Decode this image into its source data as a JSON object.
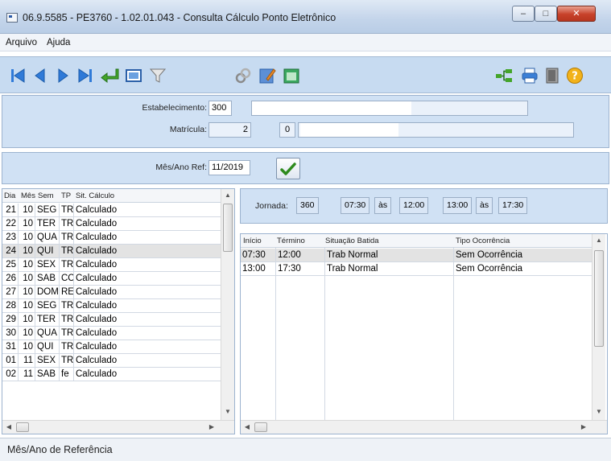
{
  "window": {
    "title": "06.9.5585 - PE3760 - 1.02.01.043 - Consulta Cálculo Ponto Eletrônico",
    "minimize": "–",
    "maximize": "□",
    "close": "✕"
  },
  "menu": {
    "arquivo": "Arquivo",
    "ajuda": "Ajuda"
  },
  "toolbar": {
    "icons": [
      "first-record-icon",
      "previous-record-icon",
      "next-record-icon",
      "last-record-icon",
      "enter-icon",
      "preview-icon",
      "filter-icon",
      "link-icon",
      "edit-icon",
      "calendar-icon",
      "tree-icon",
      "print-icon",
      "exit-door-icon",
      "help-icon"
    ]
  },
  "form": {
    "estabelecimento_label": "Estabelecimento:",
    "estabelecimento_value": "300",
    "matricula_label": "Matrícula:",
    "matricula_value": "2",
    "matricula_digit": "0",
    "mes_ano_label": "Mês/Ano Ref:",
    "mes_ano_value": "11/2019"
  },
  "days_grid": {
    "headers": [
      "Dia",
      "Mês",
      "Sem",
      "TP",
      "Sit. Cálculo"
    ],
    "rows": [
      [
        "21",
        "10",
        "SEG",
        "TR",
        "Calculado"
      ],
      [
        "22",
        "10",
        "TER",
        "TR",
        "Calculado"
      ],
      [
        "23",
        "10",
        "QUA",
        "TR",
        "Calculado"
      ],
      [
        "24",
        "10",
        "QUI",
        "TR",
        "Calculado"
      ],
      [
        "25",
        "10",
        "SEX",
        "TR",
        "Calculado"
      ],
      [
        "26",
        "10",
        "SAB",
        "CC",
        "Calculado"
      ],
      [
        "27",
        "10",
        "DOM",
        "RE",
        "Calculado"
      ],
      [
        "28",
        "10",
        "SEG",
        "TR",
        "Calculado"
      ],
      [
        "29",
        "10",
        "TER",
        "TR",
        "Calculado"
      ],
      [
        "30",
        "10",
        "QUA",
        "TR",
        "Calculado"
      ],
      [
        "31",
        "10",
        "QUI",
        "TR",
        "Calculado"
      ],
      [
        "01",
        "11",
        "SEX",
        "TR",
        "Calculado"
      ],
      [
        "02",
        "11",
        "SAB",
        "fe",
        "Calculado"
      ]
    ],
    "selected_row": 3
  },
  "jornada": {
    "label": "Jornada:",
    "code": "360",
    "start1": "07:30",
    "as1": "às",
    "end1": "12:00",
    "start2": "13:00",
    "as2": "às",
    "end2": "17:30"
  },
  "punches_grid": {
    "headers": [
      "Início",
      "Término",
      "Situação Batida",
      "Tipo Ocorrência"
    ],
    "rows": [
      [
        "07:30",
        "12:00",
        "Trab Normal",
        "Sem Ocorrência"
      ],
      [
        "13:00",
        "17:30",
        "Trab Normal",
        "Sem Ocorrência"
      ]
    ],
    "selected_row": 0
  },
  "status": {
    "text": "Mês/Ano de Referência"
  }
}
